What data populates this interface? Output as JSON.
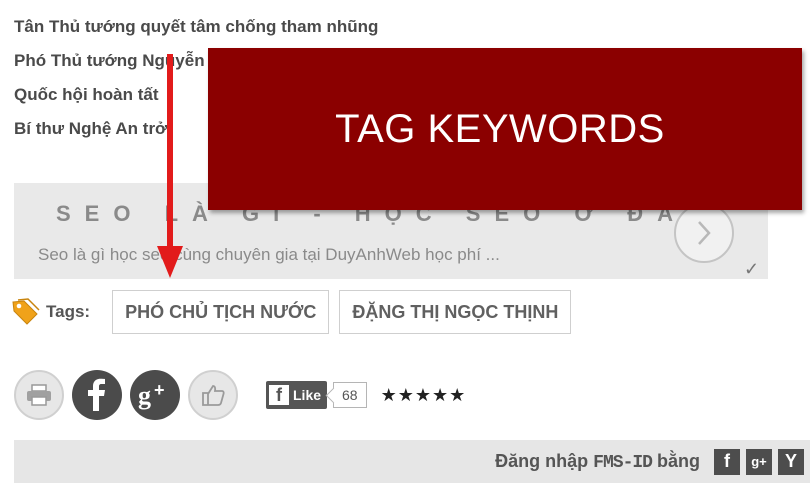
{
  "news": [
    "Tân Thủ tướng quyết tâm chống tham nhũng",
    "Phó Thủ tướng Nguyễn",
    "Quốc hội hoàn tất",
    "Bí thư Nghệ An trở"
  ],
  "overlay": {
    "label": "TAG KEYWORDS",
    "color": "#8b0000"
  },
  "promo": {
    "title": "SEO LÀ GÌ - HỌC SEO Ở ĐÂU",
    "subtitle": "Seo là gì học seo cùng chuyên gia tại DuyAnhWeb học phí ...",
    "next_icon": "chevron-right-icon",
    "check_icon": "checkmark-icon"
  },
  "tags": {
    "label": "Tags:",
    "icon": "tag-icon",
    "items": [
      "PHÓ CHỦ TỊCH NƯỚC",
      "ĐẶNG THỊ NGỌC THỊNH"
    ]
  },
  "social": {
    "buttons": [
      "print-icon",
      "facebook-icon",
      "google-plus-icon",
      "thumbs-up-icon"
    ],
    "fb_like_label": "Like",
    "fb_like_count": "68",
    "rating": "★★★★★"
  },
  "login": {
    "text": "Đăng nhập",
    "brand": "FMS-ID",
    "suffix": "bằng",
    "providers": [
      "facebook-icon",
      "google-plus-icon",
      "yahoo-icon"
    ]
  }
}
